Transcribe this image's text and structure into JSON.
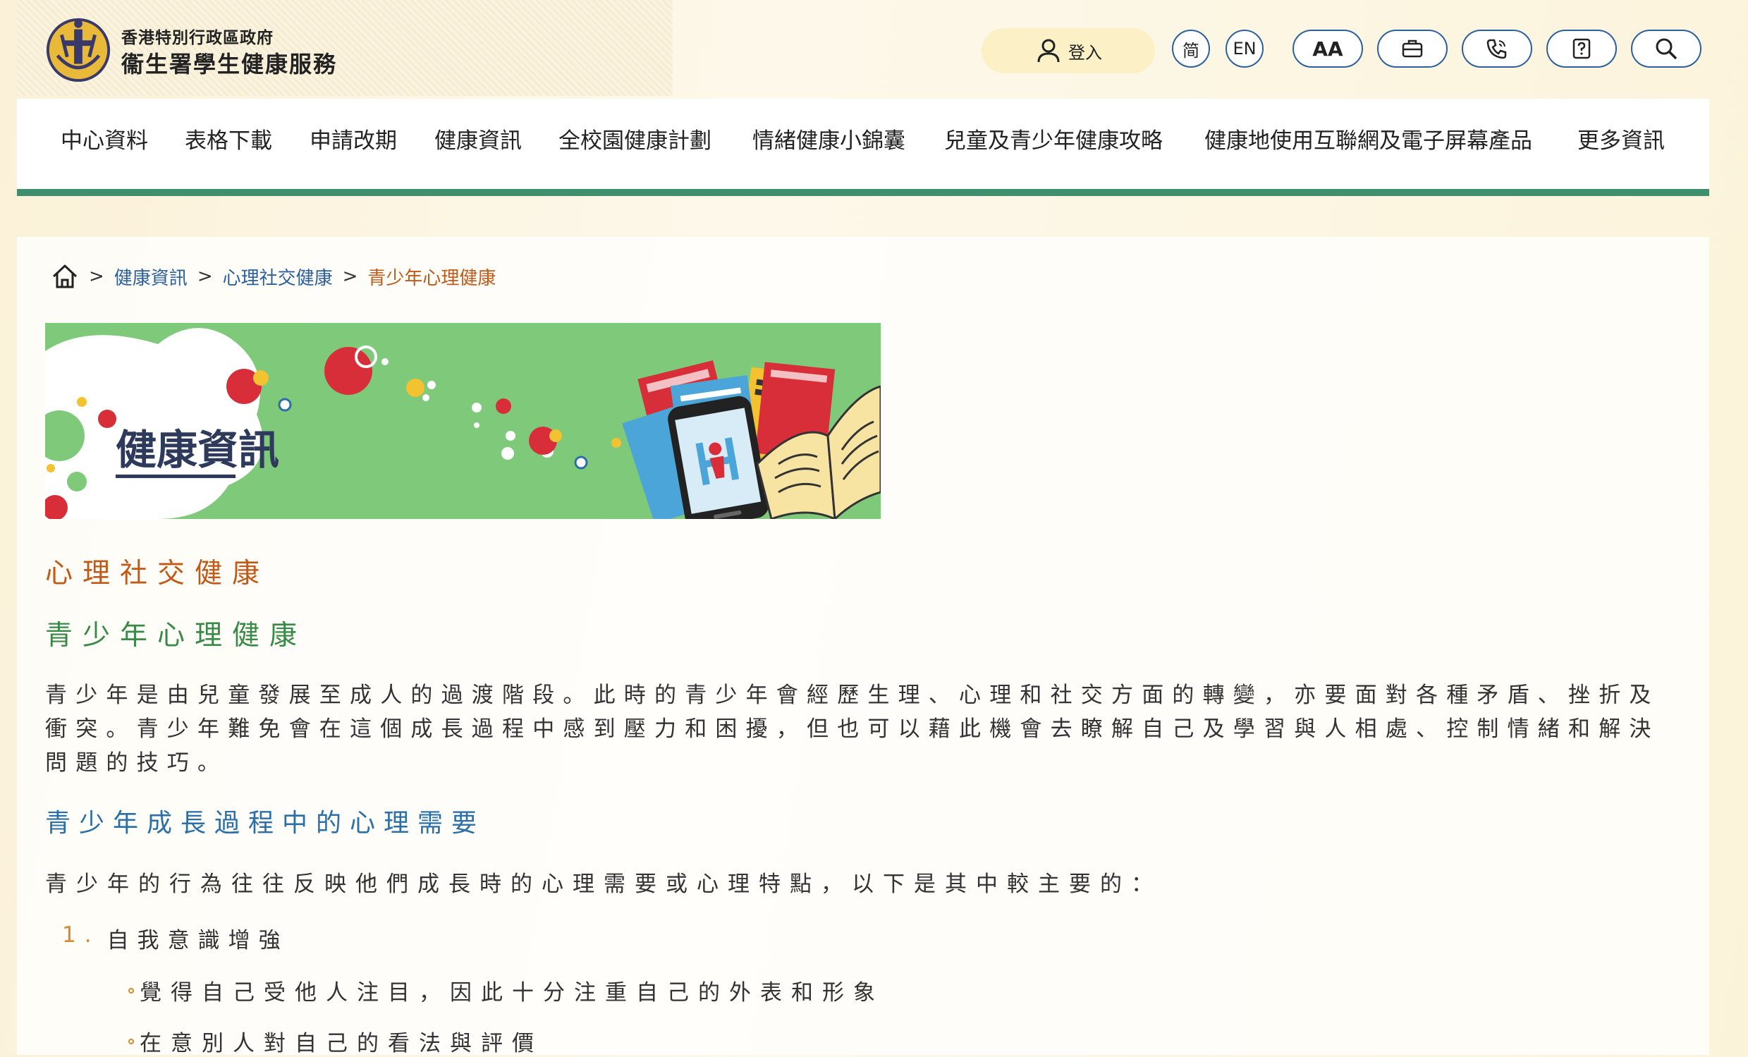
{
  "header": {
    "org_line1": "香港特別行政區政府",
    "org_line2": "衞生署學生健康服務",
    "login_label": "登入",
    "lang_simplified": "简",
    "lang_english": "EN",
    "font_size_label": "AA"
  },
  "nav": {
    "items": [
      "中心資料",
      "表格下載",
      "申請改期",
      "健康資訊",
      "全校園健康計劃",
      "情緒健康小錦囊",
      "兒童及青少年健康攻略",
      "健康地使用互聯網及電子屏幕產品",
      "更多資訊"
    ]
  },
  "breadcrumb": {
    "items": [
      "健康資訊",
      "心理社交健康"
    ],
    "current": "青少年心理健康"
  },
  "banner": {
    "title": "健康資訊"
  },
  "article": {
    "section_title": "心理社交健康",
    "topic_title": "青少年心理健康",
    "intro": "青少年是由兒童發展至成人的過渡階段。此時的青少年會經歷生理、心理和社交方面的轉變，亦要面對各種矛盾、挫折及衝突。青少年難免會在這個成長過程中感到壓力和困擾，但也可以藉此機會去瞭解自己及學習與人相處、控制情緒和解決問題的技巧。",
    "subheading": "青少年成長過程中的心理需要",
    "lead": "青少年的行為往往反映他們成長時的心理需要或心理特點，以下是其中較主要的：",
    "list": [
      {
        "num": "1.",
        "title": "自我意識增強",
        "bullets": [
          "覺得自己受他人注目，因此十分注重自己的外表和形象",
          "在意別人對自己的看法與評價"
        ]
      }
    ]
  },
  "colors": {
    "accent_orange": "#c15a17",
    "accent_green": "#3a8a47",
    "accent_blue": "#2b6fa8",
    "nav_bar": "#3f8f6c",
    "button_border": "#2b5f9e"
  }
}
